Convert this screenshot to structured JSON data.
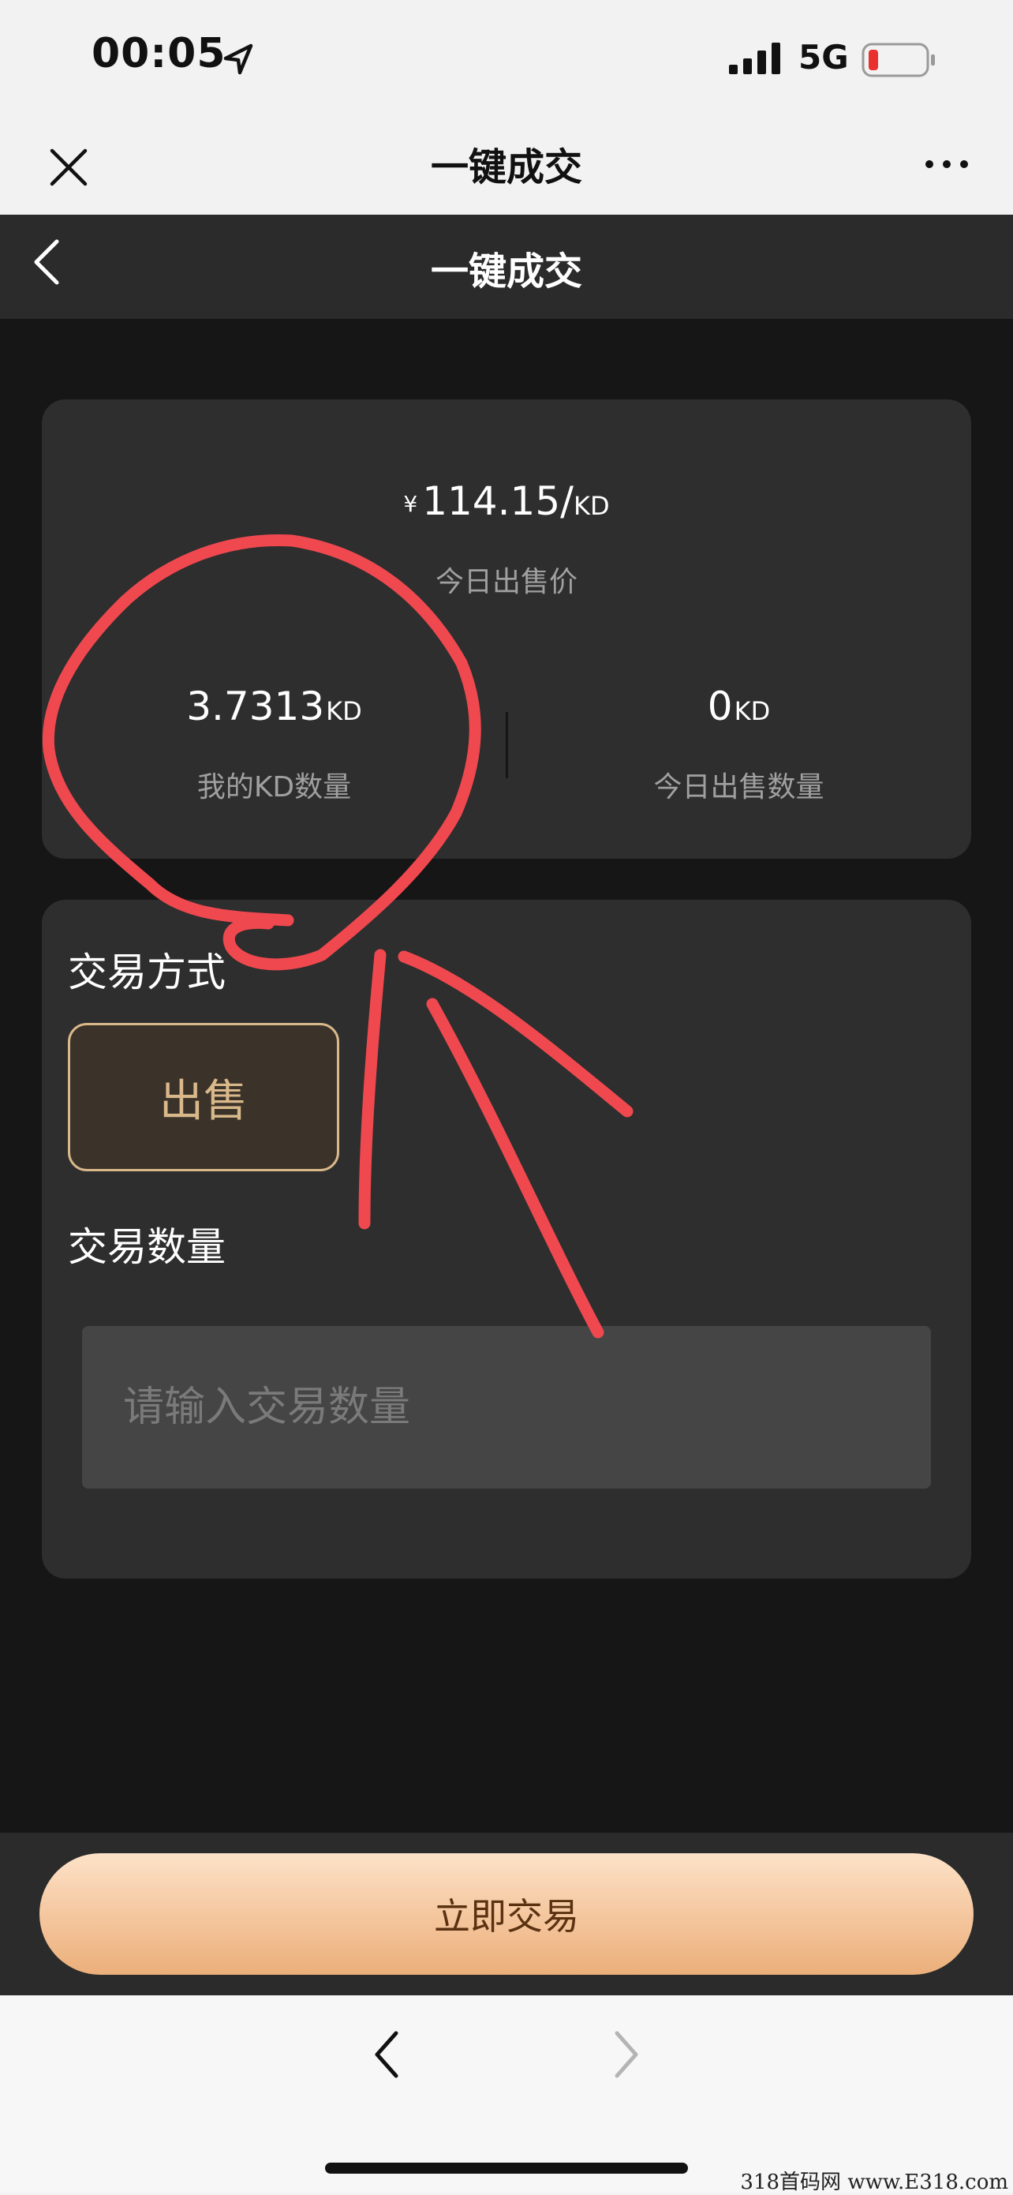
{
  "status_bar": {
    "time": "00:05",
    "network": "5G",
    "icons": [
      "location-arrow-icon",
      "signal-icon",
      "battery-low-icon"
    ]
  },
  "browser": {
    "title": "一键成交",
    "icons": [
      "close-icon",
      "more-icon"
    ]
  },
  "app_header": {
    "title": "一键成交",
    "icons": [
      "back-icon"
    ]
  },
  "stats": {
    "price": {
      "currency": "¥",
      "value": "114.15",
      "separator": "/",
      "unit": "KD",
      "label": "今日出售价"
    },
    "my_kd": {
      "value": "3.7313",
      "unit": "KD",
      "label": "我的KD数量"
    },
    "today_sold": {
      "value": "0",
      "unit": "KD",
      "label": "今日出售数量"
    }
  },
  "trade": {
    "method_label": "交易方式",
    "method_button": "出售",
    "quantity_label": "交易数量",
    "quantity_placeholder": "请输入交易数量",
    "quantity_value": ""
  },
  "actions": {
    "submit_label": "立即交易"
  },
  "browser_nav": {
    "icons": [
      "nav-back-icon",
      "nav-forward-icon"
    ]
  },
  "watermark": "318首码网 www.E318.com",
  "colors": {
    "page_bg": "#161616",
    "card_bg": "#2e2e2e",
    "accent_gold": "#d9b88a",
    "button_gradient_top": "#fde2c8",
    "button_gradient_bottom": "#ebaf7a",
    "annotation_red": "#f0484f"
  }
}
